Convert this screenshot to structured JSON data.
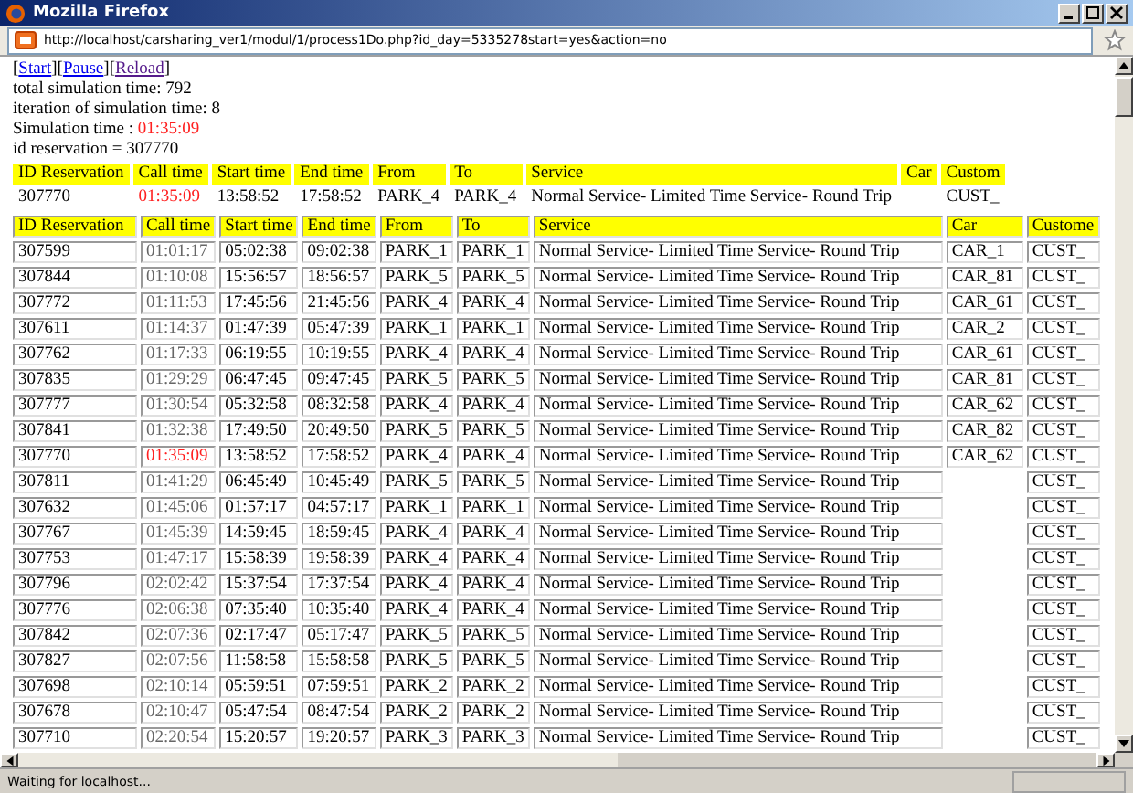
{
  "window": {
    "title": "Mozilla Firefox"
  },
  "address_bar": {
    "url": "http://localhost/carsharing_ver1/modul/1/process1Do.php?id_day=5335278start=yes&action=no"
  },
  "links": [
    {
      "before": "[",
      "label": "Start",
      "after": "]",
      "visited": false
    },
    {
      "before": "[",
      "label": "Pause",
      "after": "]",
      "visited": false
    },
    {
      "before": "[",
      "label": "Reload",
      "after": "]",
      "visited": true
    }
  ],
  "info_lines": [
    {
      "text": "total simulation time: 792"
    },
    {
      "text": "iteration of simulation time: 8"
    },
    {
      "text": "Simulation time : ",
      "value": "01:35:09"
    },
    {
      "text": "id reservation = 307770"
    }
  ],
  "current_reservation": {
    "columns": [
      "ID Reservation",
      "Call time",
      "Start time",
      "End time",
      "From",
      "To",
      "Service",
      "Car",
      "Custom"
    ],
    "row": {
      "id": "307770",
      "call": "01:35:09",
      "start": "13:58:52",
      "end": "17:58:52",
      "from": "PARK_4",
      "to": "PARK_4",
      "service": "Normal Service- Limited Time Service- Round Trip",
      "customer": "CUST_",
      "current": true
    }
  },
  "table": {
    "columns": [
      "ID Reservation",
      "Call time",
      "Start time",
      "End time",
      "From",
      "To",
      "Service",
      "Car",
      "Custome"
    ],
    "rows": [
      {
        "id": "307599",
        "call": "01:01:17",
        "start": "05:02:38",
        "end": "09:02:38",
        "from": "PARK_1",
        "to": "PARK_1",
        "service": "Normal Service- Limited Time Service- Round Trip",
        "car": "CAR_1",
        "customer": "CUST_",
        "current": false
      },
      {
        "id": "307844",
        "call": "01:10:08",
        "start": "15:56:57",
        "end": "18:56:57",
        "from": "PARK_5",
        "to": "PARK_5",
        "service": "Normal Service- Limited Time Service- Round Trip",
        "car": "CAR_81",
        "customer": "CUST_",
        "current": false
      },
      {
        "id": "307772",
        "call": "01:11:53",
        "start": "17:45:56",
        "end": "21:45:56",
        "from": "PARK_4",
        "to": "PARK_4",
        "service": "Normal Service- Limited Time Service- Round Trip",
        "car": "CAR_61",
        "customer": "CUST_",
        "current": false
      },
      {
        "id": "307611",
        "call": "01:14:37",
        "start": "01:47:39",
        "end": "05:47:39",
        "from": "PARK_1",
        "to": "PARK_1",
        "service": "Normal Service- Limited Time Service- Round Trip",
        "car": "CAR_2",
        "customer": "CUST_",
        "current": false
      },
      {
        "id": "307762",
        "call": "01:17:33",
        "start": "06:19:55",
        "end": "10:19:55",
        "from": "PARK_4",
        "to": "PARK_4",
        "service": "Normal Service- Limited Time Service- Round Trip",
        "car": "CAR_61",
        "customer": "CUST_",
        "current": false
      },
      {
        "id": "307835",
        "call": "01:29:29",
        "start": "06:47:45",
        "end": "09:47:45",
        "from": "PARK_5",
        "to": "PARK_5",
        "service": "Normal Service- Limited Time Service- Round Trip",
        "car": "CAR_81",
        "customer": "CUST_",
        "current": false
      },
      {
        "id": "307777",
        "call": "01:30:54",
        "start": "05:32:58",
        "end": "08:32:58",
        "from": "PARK_4",
        "to": "PARK_4",
        "service": "Normal Service- Limited Time Service- Round Trip",
        "car": "CAR_62",
        "customer": "CUST_",
        "current": false
      },
      {
        "id": "307841",
        "call": "01:32:38",
        "start": "17:49:50",
        "end": "20:49:50",
        "from": "PARK_5",
        "to": "PARK_5",
        "service": "Normal Service- Limited Time Service- Round Trip",
        "car": "CAR_82",
        "customer": "CUST_",
        "current": false
      },
      {
        "id": "307770",
        "call": "01:35:09",
        "start": "13:58:52",
        "end": "17:58:52",
        "from": "PARK_4",
        "to": "PARK_4",
        "service": "Normal Service- Limited Time Service- Round Trip",
        "car": "CAR_62",
        "customer": "CUST_",
        "current": true
      },
      {
        "id": "307811",
        "call": "01:41:29",
        "start": "06:45:49",
        "end": "10:45:49",
        "from": "PARK_5",
        "to": "PARK_5",
        "service": "Normal Service- Limited Time Service- Round Trip",
        "customer": "CUST_",
        "current": false
      },
      {
        "id": "307632",
        "call": "01:45:06",
        "start": "01:57:17",
        "end": "04:57:17",
        "from": "PARK_1",
        "to": "PARK_1",
        "service": "Normal Service- Limited Time Service- Round Trip",
        "customer": "CUST_",
        "current": false
      },
      {
        "id": "307767",
        "call": "01:45:39",
        "start": "14:59:45",
        "end": "18:59:45",
        "from": "PARK_4",
        "to": "PARK_4",
        "service": "Normal Service- Limited Time Service- Round Trip",
        "customer": "CUST_",
        "current": false
      },
      {
        "id": "307753",
        "call": "01:47:17",
        "start": "15:58:39",
        "end": "19:58:39",
        "from": "PARK_4",
        "to": "PARK_4",
        "service": "Normal Service- Limited Time Service- Round Trip",
        "customer": "CUST_",
        "current": false
      },
      {
        "id": "307796",
        "call": "02:02:42",
        "start": "15:37:54",
        "end": "17:37:54",
        "from": "PARK_4",
        "to": "PARK_4",
        "service": "Normal Service- Limited Time Service- Round Trip",
        "customer": "CUST_",
        "current": false
      },
      {
        "id": "307776",
        "call": "02:06:38",
        "start": "07:35:40",
        "end": "10:35:40",
        "from": "PARK_4",
        "to": "PARK_4",
        "service": "Normal Service- Limited Time Service- Round Trip",
        "customer": "CUST_",
        "current": false
      },
      {
        "id": "307842",
        "call": "02:07:36",
        "start": "02:17:47",
        "end": "05:17:47",
        "from": "PARK_5",
        "to": "PARK_5",
        "service": "Normal Service- Limited Time Service- Round Trip",
        "customer": "CUST_",
        "current": false
      },
      {
        "id": "307827",
        "call": "02:07:56",
        "start": "11:58:58",
        "end": "15:58:58",
        "from": "PARK_5",
        "to": "PARK_5",
        "service": "Normal Service- Limited Time Service- Round Trip",
        "customer": "CUST_",
        "current": false
      },
      {
        "id": "307698",
        "call": "02:10:14",
        "start": "05:59:51",
        "end": "07:59:51",
        "from": "PARK_2",
        "to": "PARK_2",
        "service": "Normal Service- Limited Time Service- Round Trip",
        "customer": "CUST_",
        "current": false
      },
      {
        "id": "307678",
        "call": "02:10:47",
        "start": "05:47:54",
        "end": "08:47:54",
        "from": "PARK_2",
        "to": "PARK_2",
        "service": "Normal Service- Limited Time Service- Round Trip",
        "customer": "CUST_",
        "current": false
      },
      {
        "id": "307710",
        "call": "02:20:54",
        "start": "15:20:57",
        "end": "19:20:57",
        "from": "PARK_3",
        "to": "PARK_3",
        "service": "Normal Service- Limited Time Service- Round Trip",
        "customer": "CUST_",
        "current": false
      }
    ]
  },
  "status_bar": {
    "text": "Waiting for localhost..."
  }
}
